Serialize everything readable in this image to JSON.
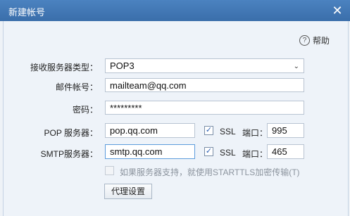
{
  "window": {
    "title": "新建帐号",
    "close": "✕"
  },
  "help": {
    "label": "帮助",
    "icon": "?"
  },
  "form": {
    "server_type_label": "接收服务器类型：",
    "server_type_value": "POP3",
    "account_label": "邮件帐号：",
    "account_value": "mailteam@qq.com",
    "password_label": "密码：",
    "password_value": "*********",
    "pop_label": "POP 服务器：",
    "pop_value": "pop.qq.com",
    "pop_ssl_label": "SSL",
    "pop_ssl_checked": true,
    "pop_port_label": "端口：",
    "pop_port_value": "995",
    "smtp_label": "SMTP服务器：",
    "smtp_value": "smtp.qq.com",
    "smtp_ssl_label": "SSL",
    "smtp_ssl_checked": true,
    "smtp_port_label": "端口：",
    "smtp_port_value": "465",
    "starttls_label": "如果服务器支持，就使用STARTTLS加密传输(T)",
    "starttls_checked": false,
    "proxy_button": "代理设置"
  },
  "icons": {
    "close": "close-icon",
    "help": "help-circle-icon",
    "dropdown": "chevron-down-icon",
    "check": "checkmark-icon"
  },
  "colors": {
    "titlebar": "#3c6fa8",
    "content_bg": "#eef3f9",
    "focus_border": "#5d9cdc",
    "check_color": "#2a5fb4"
  }
}
